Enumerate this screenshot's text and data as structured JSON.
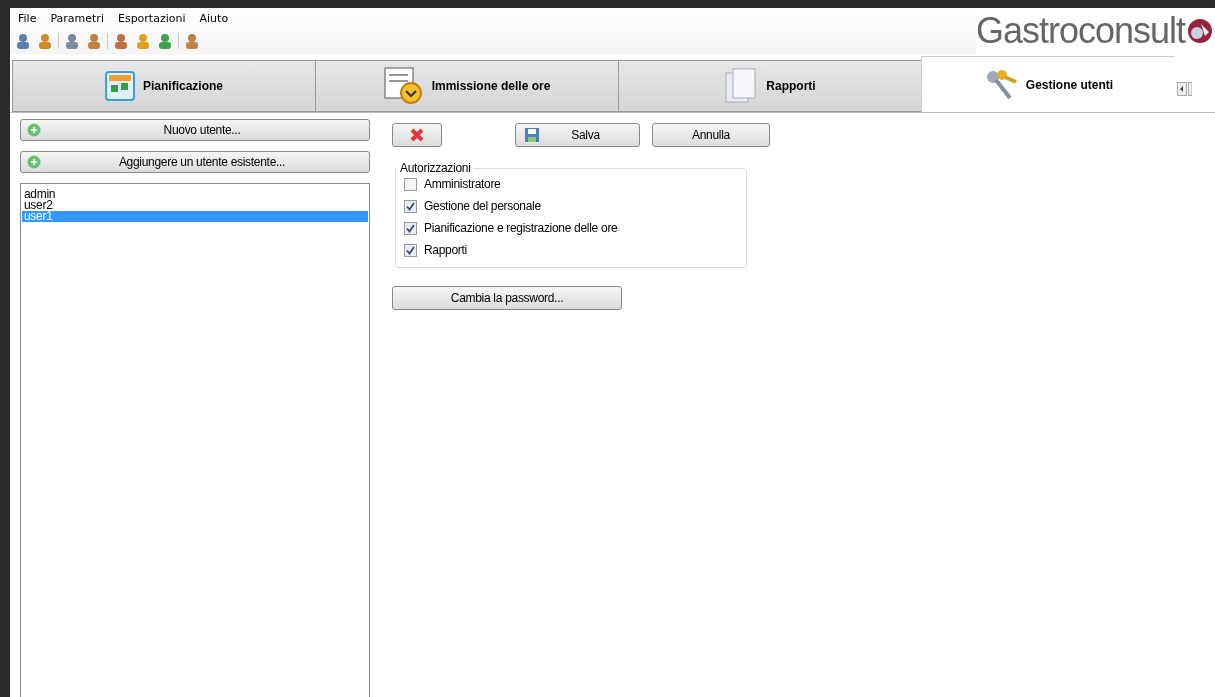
{
  "menu": [
    "File",
    "Parametri",
    "Esportazioni",
    "Aiuto"
  ],
  "logo": {
    "text": "Gastroconsult"
  },
  "tabs": [
    {
      "label": "Pianificazione",
      "selected": false
    },
    {
      "label": "Immissione delle ore",
      "selected": false
    },
    {
      "label": "Rapporti",
      "selected": false
    },
    {
      "label": "Gestione utenti",
      "selected": true
    }
  ],
  "sidebar": {
    "buttons": [
      "Nuovo utente...",
      "Aggiungere un utente esistente..."
    ],
    "users": [
      {
        "label": "admin",
        "selected": false
      },
      {
        "label": "user2",
        "selected": false
      },
      {
        "label": "user1",
        "selected": true
      }
    ]
  },
  "actions": {
    "save": "Salva",
    "cancel": "Annulla"
  },
  "permissions": {
    "title": "Autorizzazioni",
    "items": [
      {
        "label": "Amministratore",
        "checked": false
      },
      {
        "label": "Gestione del personale",
        "checked": true
      },
      {
        "label": "Pianificazione e registrazione delle ore",
        "checked": true
      },
      {
        "label": "Rapporti",
        "checked": true
      }
    ]
  },
  "password_button": "Cambia la password..."
}
